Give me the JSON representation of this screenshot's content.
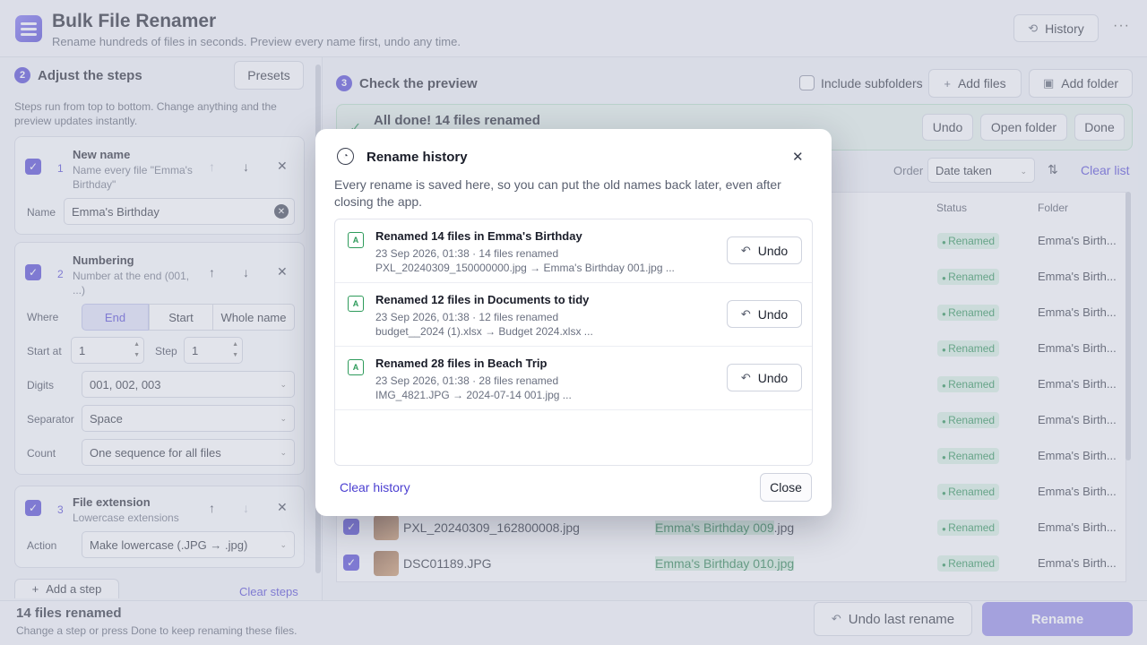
{
  "header": {
    "title": "Bulk File Renamer",
    "subtitle": "Rename hundreds of files in seconds. Preview every name first, undo any time.",
    "history_label": "History",
    "more_label": "···"
  },
  "steps_panel": {
    "step_number": "2",
    "title": "Adjust the steps",
    "presets_label": "Presets",
    "description": "Steps run from top to bottom. Change anything and the preview updates instantly.",
    "cards": [
      {
        "index": "1",
        "title": "New name",
        "desc": "Name every file \"Emma's Birthday\"",
        "name_label": "Name",
        "name_value": "Emma's Birthday"
      },
      {
        "index": "2",
        "title": "Numbering",
        "desc": "Number at the end (001, ...)",
        "where_label": "Where",
        "where_options": [
          "End",
          "Start",
          "Whole name"
        ],
        "start_label": "Start at",
        "start_value": "1",
        "step_label": "Step",
        "step_value": "1",
        "digits_label": "Digits",
        "digits_value": "001, 002, 003",
        "separator_label": "Separator",
        "separator_value": "Space",
        "count_label": "Count",
        "count_value": "One sequence for all files"
      },
      {
        "index": "3",
        "title": "File extension",
        "desc": "Lowercase extensions",
        "action_label": "Action",
        "action_value": "Make lowercase (.JPG → .jpg)"
      }
    ],
    "add_step_label": "Add a step",
    "clear_steps_label": "Clear steps"
  },
  "preview": {
    "step_number": "3",
    "title": "Check the preview",
    "include_subfolders": "Include subfolders",
    "add_files": "Add files",
    "add_folder": "Add folder",
    "banner_title": "All done! 14 files renamed",
    "banner_undo": "Undo",
    "banner_open": "Open folder",
    "banner_done": "Done",
    "order_label": "Order",
    "order_value": "Date taken",
    "clear_list": "Clear list",
    "col_status": "Status",
    "col_folder": "Folder",
    "rows": [
      {
        "status": "Renamed",
        "folder": "Emma's Birth..."
      },
      {
        "status": "Renamed",
        "folder": "Emma's Birth..."
      },
      {
        "status": "Renamed",
        "folder": "Emma's Birth..."
      },
      {
        "status": "Renamed",
        "folder": "Emma's Birth..."
      },
      {
        "status": "Renamed",
        "folder": "Emma's Birth..."
      },
      {
        "status": "Renamed",
        "folder": "Emma's Birth..."
      },
      {
        "status": "Renamed",
        "folder": "Emma's Birth..."
      },
      {
        "status": "Renamed",
        "folder": "Emma's Birth..."
      },
      {
        "status": "Renamed",
        "folder": "Emma's Birth...",
        "original": "PXL_20240309_162800008.jpg",
        "new_hl": "Emma's Birthday 009",
        "new_rest": ".jpg"
      },
      {
        "status": "Renamed",
        "folder": "Emma's Birth...",
        "original": "DSC01189.JPG",
        "new_hl": "Emma's Birthday 010.jpg",
        "new_rest": ""
      }
    ]
  },
  "footer": {
    "status_title": "14 files renamed",
    "status_desc": "Change a step or press Done to keep renaming these files.",
    "undo_last": "Undo last rename",
    "rename": "Rename"
  },
  "modal": {
    "title": "Rename history",
    "description": "Every rename is saved here, so you can put the old names back later, even after closing the app.",
    "items": [
      {
        "title": "Renamed 14 files in Emma's Birthday",
        "meta": "23 Sep 2026, 01:38  ·  14 files renamed",
        "files": "PXL_20240309_150000000.jpg  →  Emma's Birthday 001.jpg   ...",
        "undo": "Undo"
      },
      {
        "title": "Renamed 12 files in Documents to tidy",
        "meta": "23 Sep 2026, 01:38  ·  12 files renamed",
        "files": "budget__2024 (1).xlsx  →  Budget 2024.xlsx   ...",
        "undo": "Undo"
      },
      {
        "title": "Renamed 28 files in Beach Trip",
        "meta": "23 Sep 2026, 01:38  ·  28 files renamed",
        "files": "IMG_4821.JPG  →  2024-07-14 001.jpg   ...",
        "undo": "Undo"
      }
    ],
    "clear_history": "Clear history",
    "close": "Close"
  }
}
